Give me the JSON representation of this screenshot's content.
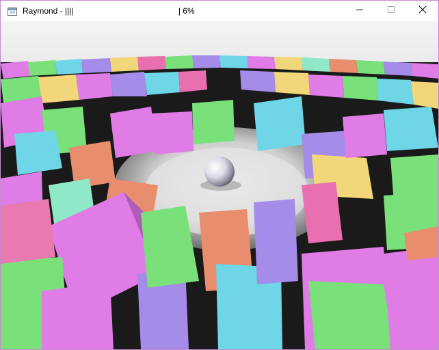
{
  "window": {
    "title": "Raymond - ||||                                              | 6%",
    "icons": {
      "app": "app-window-icon",
      "minimize": "minimize-icon",
      "maximize": "maximize-icon",
      "close": "close-icon"
    }
  },
  "scene": {
    "description_items": [
      "floor",
      "mirror-sphere",
      "colored-cubes"
    ],
    "cube_colors": [
      "#e07ce6",
      "#79e07a",
      "#f2d77a",
      "#6fd6e8",
      "#a58ce8",
      "#e88d6d",
      "#e86fb0",
      "#8fe8c7"
    ]
  }
}
